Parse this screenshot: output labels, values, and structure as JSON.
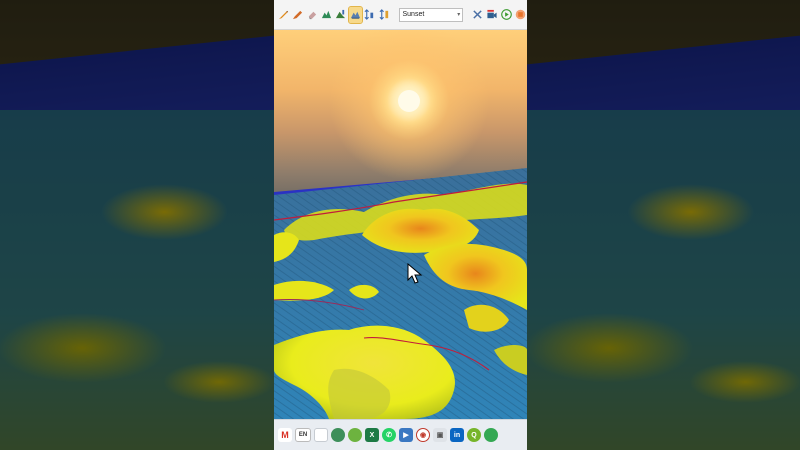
{
  "toolbar": {
    "sky_preset_value": "Sunset",
    "buttons": [
      {
        "icon": "pencil-icon",
        "color": "#e08a1a"
      },
      {
        "icon": "ruler-pencil-icon",
        "color": "#d26b28"
      },
      {
        "icon": "eraser-icon",
        "color": "#b58a8a"
      },
      {
        "icon": "terrain-profile-icon",
        "color": "#2e8b57"
      },
      {
        "icon": "terrain-edit-icon",
        "color": "#3a7d3a"
      },
      {
        "icon": "3d-view-icon",
        "color": "#5a7fb0",
        "active": true
      },
      {
        "icon": "vertical-scale-icon",
        "color": "#3d6bb0"
      },
      {
        "icon": "elevation-scale-icon",
        "color": "#3d6bb0"
      }
    ],
    "right_buttons": [
      {
        "icon": "tools-icon",
        "color": "#4a6fa5"
      },
      {
        "icon": "movie-camera-icon",
        "color": "#2f5f8f"
      },
      {
        "icon": "play-icon",
        "color": "#3b9a2f"
      },
      {
        "icon": "record-icon",
        "color": "#e8742a"
      }
    ]
  },
  "colors": {
    "sea": "#2b2fd0",
    "terrain_low": "#2f7fae",
    "terrain_mid": "#e6e51a",
    "terrain_high": "#e59a1e",
    "road": "#c21c3a"
  },
  "taskbar": {
    "language": "EN",
    "apps": [
      {
        "icon": "gmail-icon",
        "color": "#d93025"
      },
      {
        "icon": "document-icon",
        "color": "#9aa4b1"
      },
      {
        "icon": "map-globe-icon",
        "color": "#3d8f5a"
      },
      {
        "icon": "xbox-icon",
        "color": "#6db33f"
      },
      {
        "icon": "excel-icon",
        "color": "#1d7a45"
      },
      {
        "icon": "whatsapp-icon",
        "color": "#25d366"
      },
      {
        "icon": "video-editor-icon",
        "color": "#3a78c2"
      },
      {
        "icon": "eye-icon",
        "color": "#c0392b"
      },
      {
        "icon": "camera-icon",
        "color": "#555555"
      },
      {
        "icon": "linkedin-icon",
        "color": "#0a66c2"
      },
      {
        "icon": "qgis-icon",
        "color": "#77b52a"
      },
      {
        "icon": "chrome-icon",
        "color": "#34a853"
      }
    ]
  }
}
